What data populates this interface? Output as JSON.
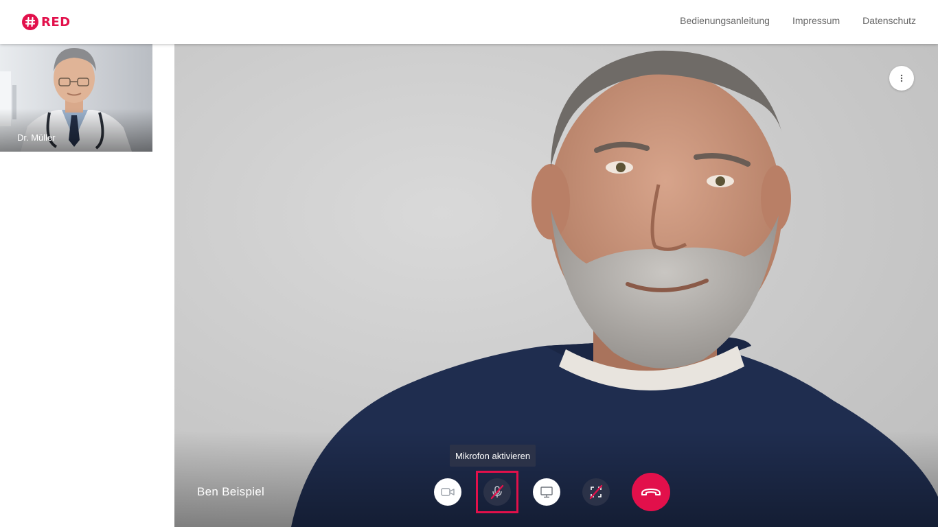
{
  "brand": {
    "logo_text": "RED",
    "logo_icon": "hashtag-icon",
    "accent": "#e2104b"
  },
  "nav": {
    "items": [
      {
        "label": "Bedienungsanleitung"
      },
      {
        "label": "Impressum"
      },
      {
        "label": "Datenschutz"
      }
    ]
  },
  "sidebar": {
    "thumbnail": {
      "name": "Dr. Müller"
    }
  },
  "main": {
    "participant_name": "Ben Beispiel",
    "more_icon": "more-vertical-icon"
  },
  "controls": {
    "camera": {
      "icon": "video-camera-icon",
      "state": "on"
    },
    "microphone": {
      "icon": "microphone-off-icon",
      "state": "muted",
      "tooltip": "Mikrofon aktivieren"
    },
    "screenshare": {
      "icon": "monitor-icon",
      "state": "off"
    },
    "fullscreen": {
      "icon": "fullscreen-off-icon",
      "state": "off"
    },
    "hangup": {
      "icon": "phone-hangup-icon"
    }
  }
}
